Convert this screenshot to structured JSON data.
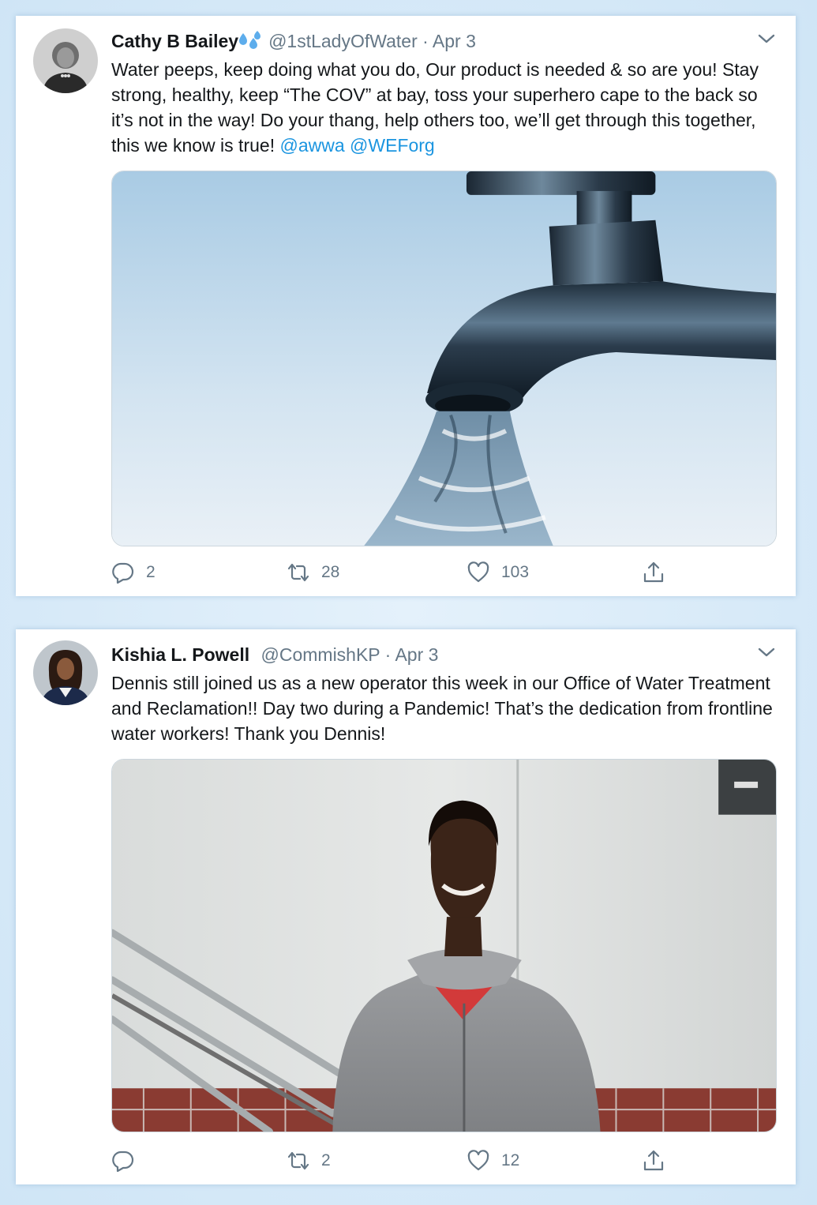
{
  "tweets": [
    {
      "author_name": "Cathy B Bailey",
      "author_emoji_icon": "sweat-droplets-icon",
      "handle": "@1stLadyOfWater",
      "separator": "·",
      "date": "Apr 3",
      "text": "Water peeps, keep doing what you do, Our product is needed & so are you! Stay strong, healthy, keep “The COV” at bay, toss your superhero cape to the back so it’s not in the way! Do your thang, help others too, we’ll get through this together, this we know is true!",
      "mentions": [
        "@awwa",
        "@WEForg"
      ],
      "media_subject": "water-faucet-photo",
      "replies": "2",
      "retweets": "28",
      "likes": "103"
    },
    {
      "author_name": "Kishia L. Powell",
      "handle": "@CommishKP",
      "separator": "·",
      "date": "Apr 3",
      "text": "Dennis still joined us as a new operator this week in our Office of Water Treatment and Reclamation!! Day two during a Pandemic! That’s the dedication from frontline water workers! Thank you Dennis!",
      "media_subject": "man-in-grey-hoodie-photo",
      "replies": "",
      "retweets": "2",
      "likes": "12"
    }
  ],
  "colors": {
    "background": "#d2e8f8",
    "card": "#ffffff",
    "name": "#14171a",
    "secondary": "#657786",
    "mention": "#1b95e0"
  }
}
